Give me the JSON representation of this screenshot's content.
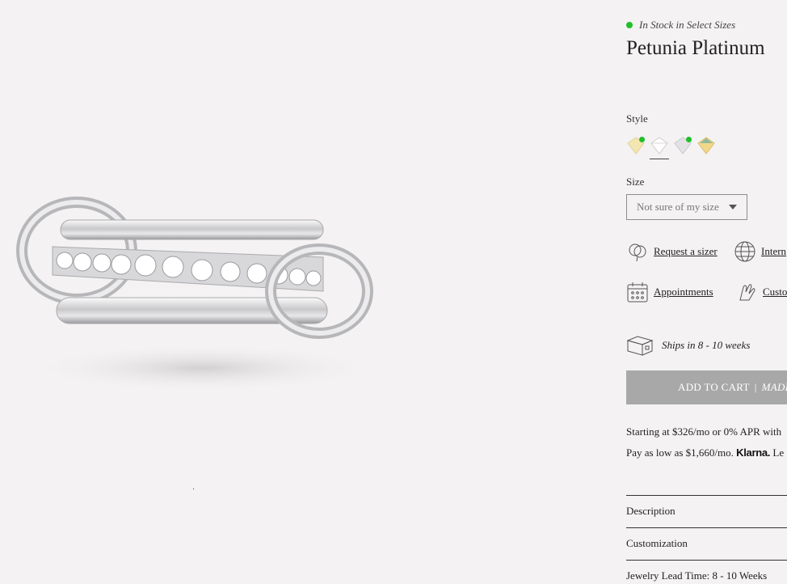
{
  "product": {
    "stock_status": "In Stock in Select Sizes",
    "title": "Petunia Platinum"
  },
  "style": {
    "label": "Style",
    "swatches": [
      {
        "name": "yellow-diamond",
        "available": true
      },
      {
        "name": "white-diamond",
        "available": false,
        "selected": true
      },
      {
        "name": "grey-diamond",
        "available": true
      },
      {
        "name": "champagne-diamond",
        "available": false
      }
    ]
  },
  "size": {
    "label": "Size",
    "selected": "Not sure of my size"
  },
  "utilities": {
    "request_sizer": "Request a sizer",
    "international": "Intern",
    "appointments": "Appointments",
    "customization": "Custo"
  },
  "shipping": {
    "text": "Ships in 8 - 10 weeks"
  },
  "cart": {
    "label": "ADD TO CART",
    "separator": "|",
    "suffix": "MADE"
  },
  "financing": {
    "line1": "Starting at $326/mo or 0% APR with",
    "line2_prefix": "Pay as low as $1,660/mo.",
    "line2_brand": "Klarna.",
    "line2_suffix": "Le"
  },
  "accordion": {
    "description": "Description",
    "customization": "Customization",
    "lead_time": "Jewelry Lead Time: 8 - 10 Weeks"
  },
  "colors": {
    "background": "#f4f2f2",
    "stock_green": "#1fbf2a",
    "button_grey": "#a8a8a8"
  }
}
